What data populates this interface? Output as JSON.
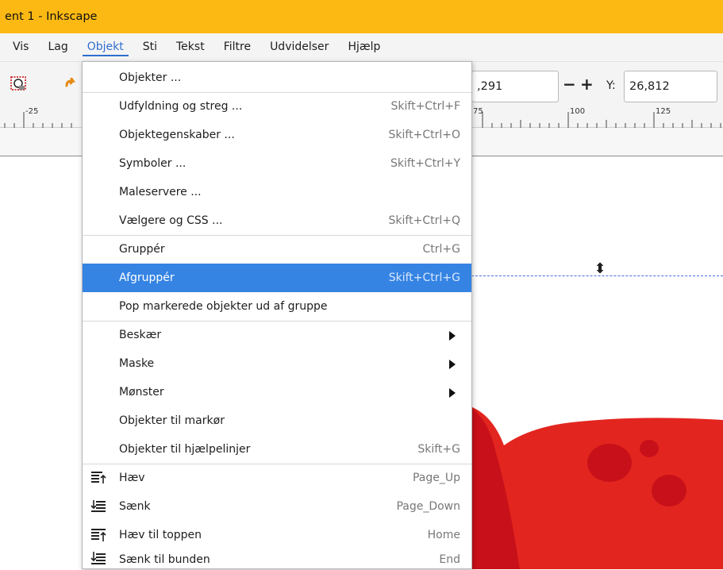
{
  "window": {
    "title": "ent 1 - Inkscape"
  },
  "menubar": {
    "items": [
      {
        "label": "Vis"
      },
      {
        "label": "Lag"
      },
      {
        "label": "Objekt"
      },
      {
        "label": "Sti"
      },
      {
        "label": "Tekst"
      },
      {
        "label": "Filtre"
      },
      {
        "label": "Udvidelser"
      },
      {
        "label": "Hjælp"
      }
    ]
  },
  "toolbar": {
    "x_value": ",291",
    "y_label": "Y:",
    "y_value": "26,812",
    "minus": "−",
    "plus": "+"
  },
  "ruler": {
    "labels": [
      "-25",
      "75",
      "100",
      "125"
    ]
  },
  "menu": {
    "items": [
      {
        "label": "Objekter ...",
        "shortcut": ""
      },
      {
        "label": "Udfyldning og streg ...",
        "shortcut": "Skift+Ctrl+F"
      },
      {
        "label": "Objektegenskaber ...",
        "shortcut": "Skift+Ctrl+O"
      },
      {
        "label": "Symboler ...",
        "shortcut": "Skift+Ctrl+Y"
      },
      {
        "label": "Maleservere ...",
        "shortcut": ""
      },
      {
        "label": "Vælgere og CSS ...",
        "shortcut": "Skift+Ctrl+Q"
      },
      {
        "label": "Gruppér",
        "shortcut": "Ctrl+G"
      },
      {
        "label": "Afgruppér",
        "shortcut": "Skift+Ctrl+G"
      },
      {
        "label": "Pop markerede objekter ud af gruppe",
        "shortcut": ""
      },
      {
        "label": "Beskær",
        "shortcut": ""
      },
      {
        "label": "Maske",
        "shortcut": ""
      },
      {
        "label": "Mønster",
        "shortcut": ""
      },
      {
        "label": "Objekter til markør",
        "shortcut": ""
      },
      {
        "label": "Objekter til hjælpelinjer",
        "shortcut": "Skift+G"
      },
      {
        "label": "Hæv",
        "shortcut": "Page_Up"
      },
      {
        "label": "Sænk",
        "shortcut": "Page_Down"
      },
      {
        "label": "Hæv til toppen",
        "shortcut": "Home"
      },
      {
        "label": "Sænk til bunden",
        "shortcut": "End"
      }
    ]
  },
  "colors": {
    "titlebar": "#fdb913",
    "highlight": "#3584e4",
    "blob_red": "#e3251f",
    "blob_dark": "#c8101a"
  }
}
